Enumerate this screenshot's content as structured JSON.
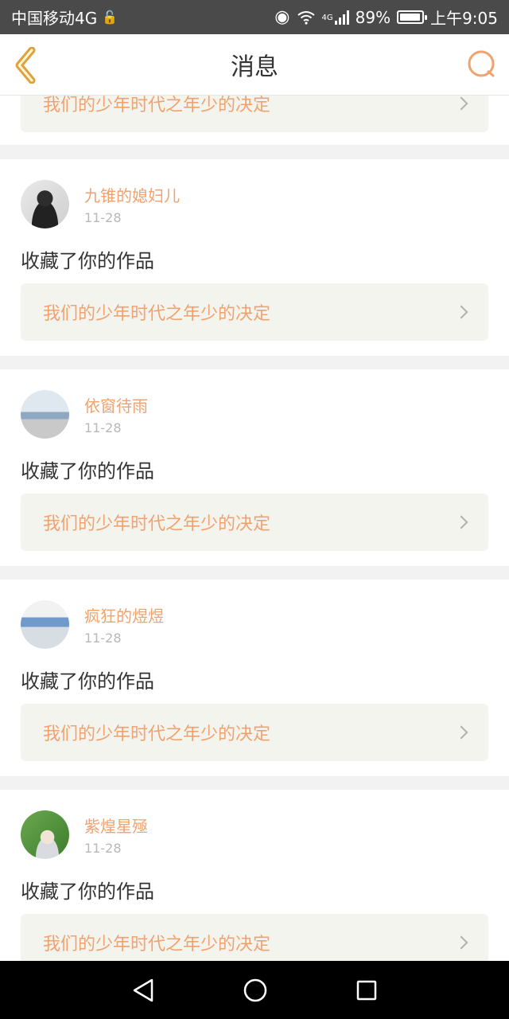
{
  "status_bar": {
    "carrier": "中国移动4G",
    "battery_percent": "89%",
    "time": "上午9:05",
    "network_badge": "4G"
  },
  "header": {
    "title": "消息",
    "back_icon": "chevron-left-icon",
    "search_icon": "search-icon"
  },
  "accent_color": "#f0a26f",
  "partial_top_item": {
    "work_title": "我们的少年时代之年少的决定"
  },
  "messages": [
    {
      "username": "九锥的媳妇儿",
      "date": "11-28",
      "action": "收藏了你的作品",
      "work_title": "我们的少年时代之年少的决定"
    },
    {
      "username": "依窗待雨",
      "date": "11-28",
      "action": "收藏了你的作品",
      "work_title": "我们的少年时代之年少的决定"
    },
    {
      "username": "疯狂的煜煜",
      "date": "11-28",
      "action": "收藏了你的作品",
      "work_title": "我们的少年时代之年少的决定"
    },
    {
      "username": "紫煌星殛",
      "date": "11-28",
      "action": "收藏了你的作品",
      "work_title": "我们的少年时代之年少的决定"
    }
  ],
  "system_nav": {
    "back": "triangle-back-icon",
    "home": "circle-home-icon",
    "recents": "square-recents-icon"
  }
}
